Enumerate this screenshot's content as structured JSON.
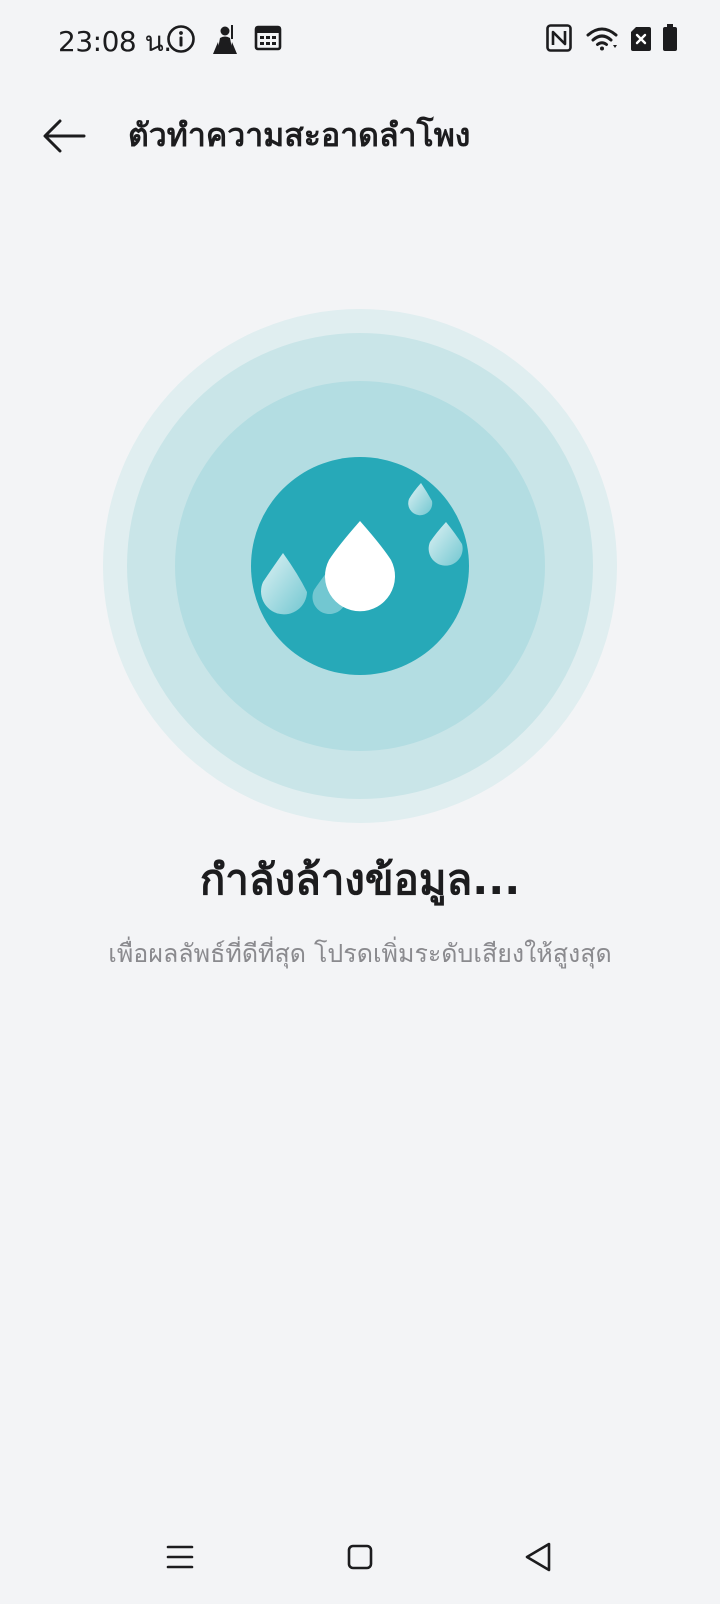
{
  "status_bar": {
    "time": "23:08 น.",
    "left_icons": [
      "info-icon",
      "game-character-icon",
      "calendar-icon"
    ],
    "right_icons": [
      "nfc-icon",
      "wifi-icon",
      "sim-disabled-icon",
      "battery-icon"
    ]
  },
  "app_bar": {
    "back_icon": "arrow-left-icon",
    "title": "ตัวทำความสะอาดลำโพง"
  },
  "main": {
    "illustration_icon": "water-drop-icon",
    "colors": {
      "ring_outer": "#e0eef0",
      "ring_middle": "#c9e5e8",
      "ring_inner": "#b3dde2",
      "core": "#27a9b8",
      "drop": "#ffffff"
    },
    "heading": "กำลังล้างข้อมูล...",
    "hint": "เพื่อผลลัพธ์ที่ดีที่สุด โปรดเพิ่มระดับเสียงให้สูงสุด"
  },
  "nav_bar": {
    "icons": [
      "menu-icon",
      "home-icon",
      "back-triangle-icon"
    ]
  }
}
